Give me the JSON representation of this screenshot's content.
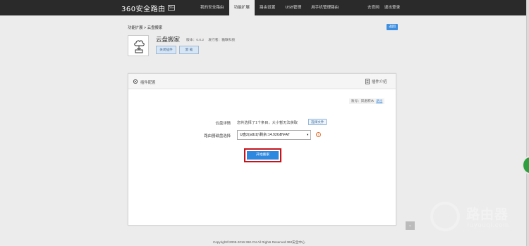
{
  "nav": {
    "logo": "360安全路由",
    "logo_badge": "5G",
    "items": [
      "我的安全路由",
      "功能扩展",
      "路由设置",
      "USB管理",
      "用手机管理路由"
    ],
    "right": [
      "去官网",
      "退出登录"
    ]
  },
  "breadcrumb": "功能扩展 > 云盘搬家",
  "return_label": "返回",
  "plugin": {
    "name": "云盘搬家",
    "version": "版本：0.0.2",
    "publisher": "发行者：雅联科技",
    "close_label": "关闭插件",
    "uninstall_label": "卸 载"
  },
  "panel": {
    "title": "插件配置",
    "intro": "插件介绍",
    "account": "账号：凤凰积木",
    "logout": "退出",
    "cloud_detail_label": "云盘详情",
    "cloud_detail_text": "您共选择了1个条目，大小暂无法获取",
    "choose_file": "选择文件",
    "disk_label": "路由器磁盘选择",
    "disk_value": "U盘2(sdb1)\\剩余:14.92GB\\FAT",
    "start_label": "开始搬家"
  },
  "footer": "Copyright©2005-2016 360.CN All Rights Reserved 360安全中心",
  "watermark": {
    "title": "路由器",
    "url": "luyouqi.com"
  },
  "colors": {
    "accent": "#2f88e0",
    "highlight": "#c7141a",
    "topbar": "#2a2a2a"
  }
}
